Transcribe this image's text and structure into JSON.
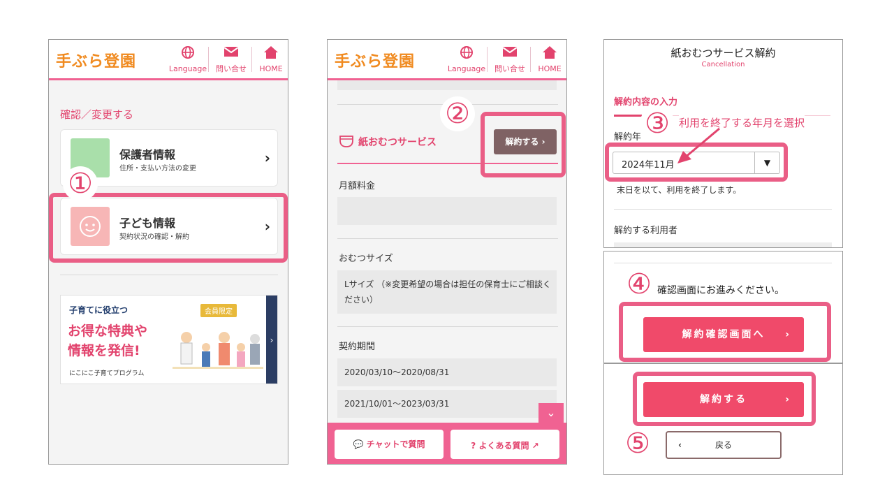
{
  "header": {
    "logo": "手ぶら登園",
    "language": "Language",
    "contact": "問い合せ",
    "home": "HOME"
  },
  "panel1": {
    "section_title": "確認／変更する",
    "guardian": {
      "title": "保護者情報",
      "sub": "住所・支払い方法の変更"
    },
    "child": {
      "title": "子ども情報",
      "sub": "契約状況の確認・解約"
    },
    "banner": {
      "line1": "子育てに役立つ",
      "line2": "お得な特典や",
      "line3": "情報を発信!",
      "line4": "にこにこ子育てプログラム",
      "tag": "会員限定"
    }
  },
  "panel2": {
    "service_title": "紙おむつサービス",
    "cancel_button": "解約する",
    "monthly_fee_label": "月額料金",
    "size_label": "おむつサイズ",
    "size_value": "Lサイズ （※変更希望の場合は担任の保育士にご相談ください）",
    "period_label": "契約期間",
    "periods": [
      "2020/03/10〜2020/08/31",
      "2021/10/01〜2023/03/31"
    ],
    "chat_button": "チャットで質問",
    "faq_button": "よくある質問"
  },
  "panel3": {
    "title": "紙おむつサービス解約",
    "subtitle": "Cancellation",
    "section": "解約内容の入力",
    "field_label": "解約年",
    "selected_month": "2024年11月",
    "note": "末日を以て、利用を終了します。",
    "user_label": "解約する利用者",
    "proceed_text": "確認画面にお進みください。",
    "confirm_button": "解約確認画面へ",
    "final_button": "解約する",
    "back_button": "戻る"
  },
  "annotations": {
    "n1": "①",
    "n2": "②",
    "n3": "③",
    "n4": "④",
    "n5": "⑤",
    "instruction": "利用を終了する年月を選択"
  },
  "colors": {
    "accent": "#e2436d",
    "brand": "#f08a1f",
    "button": "#f04a6a"
  }
}
